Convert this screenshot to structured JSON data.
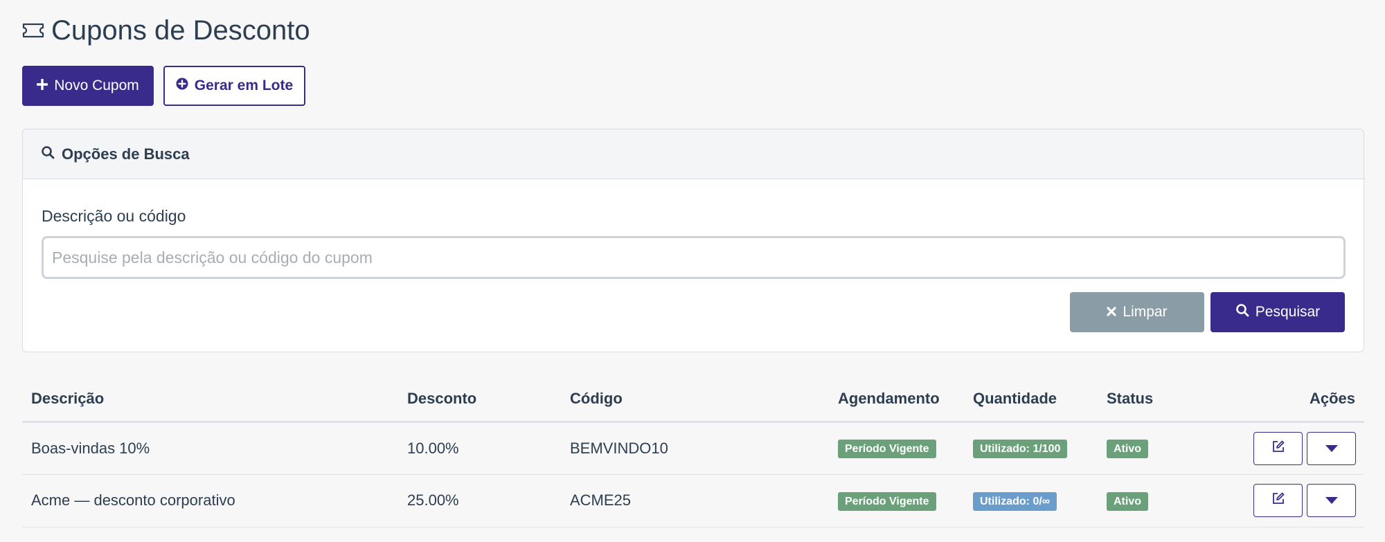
{
  "header": {
    "title": "Cupons de Desconto",
    "icon": "ticket-icon"
  },
  "toolbar": {
    "new_label": "Novo Cupom",
    "batch_label": "Gerar em Lote"
  },
  "search": {
    "card_title": "Opções de Busca",
    "field_label": "Descrição ou código",
    "placeholder": "Pesquise pela descrição ou código do cupom",
    "value": "",
    "clear_label": "Limpar",
    "search_label": "Pesquisar"
  },
  "table": {
    "columns": {
      "descricao": "Descrição",
      "desconto": "Desconto",
      "codigo": "Código",
      "agendamento": "Agendamento",
      "quantidade": "Quantidade",
      "status": "Status",
      "acoes": "Ações"
    },
    "rows": [
      {
        "descricao": "Boas-vindas 10%",
        "desconto": "10.00%",
        "codigo": "BEMVINDO10",
        "agendamento": "Período Vigente",
        "quantidade": "Utilizado: 1/100",
        "quantidade_color": "green",
        "status": "Ativo"
      },
      {
        "descricao": "Acme — desconto corporativo",
        "desconto": "25.00%",
        "codigo": "ACME25",
        "agendamento": "Período Vigente",
        "quantidade": "Utilizado: 0/∞",
        "quantidade_color": "blue",
        "status": "Ativo"
      }
    ]
  },
  "colors": {
    "primary": "#392b8c",
    "clear_button": "#8a9ca6",
    "badge_green": "#6aa17a",
    "badge_blue": "#6a9ccc",
    "text": "#2c3e50"
  }
}
